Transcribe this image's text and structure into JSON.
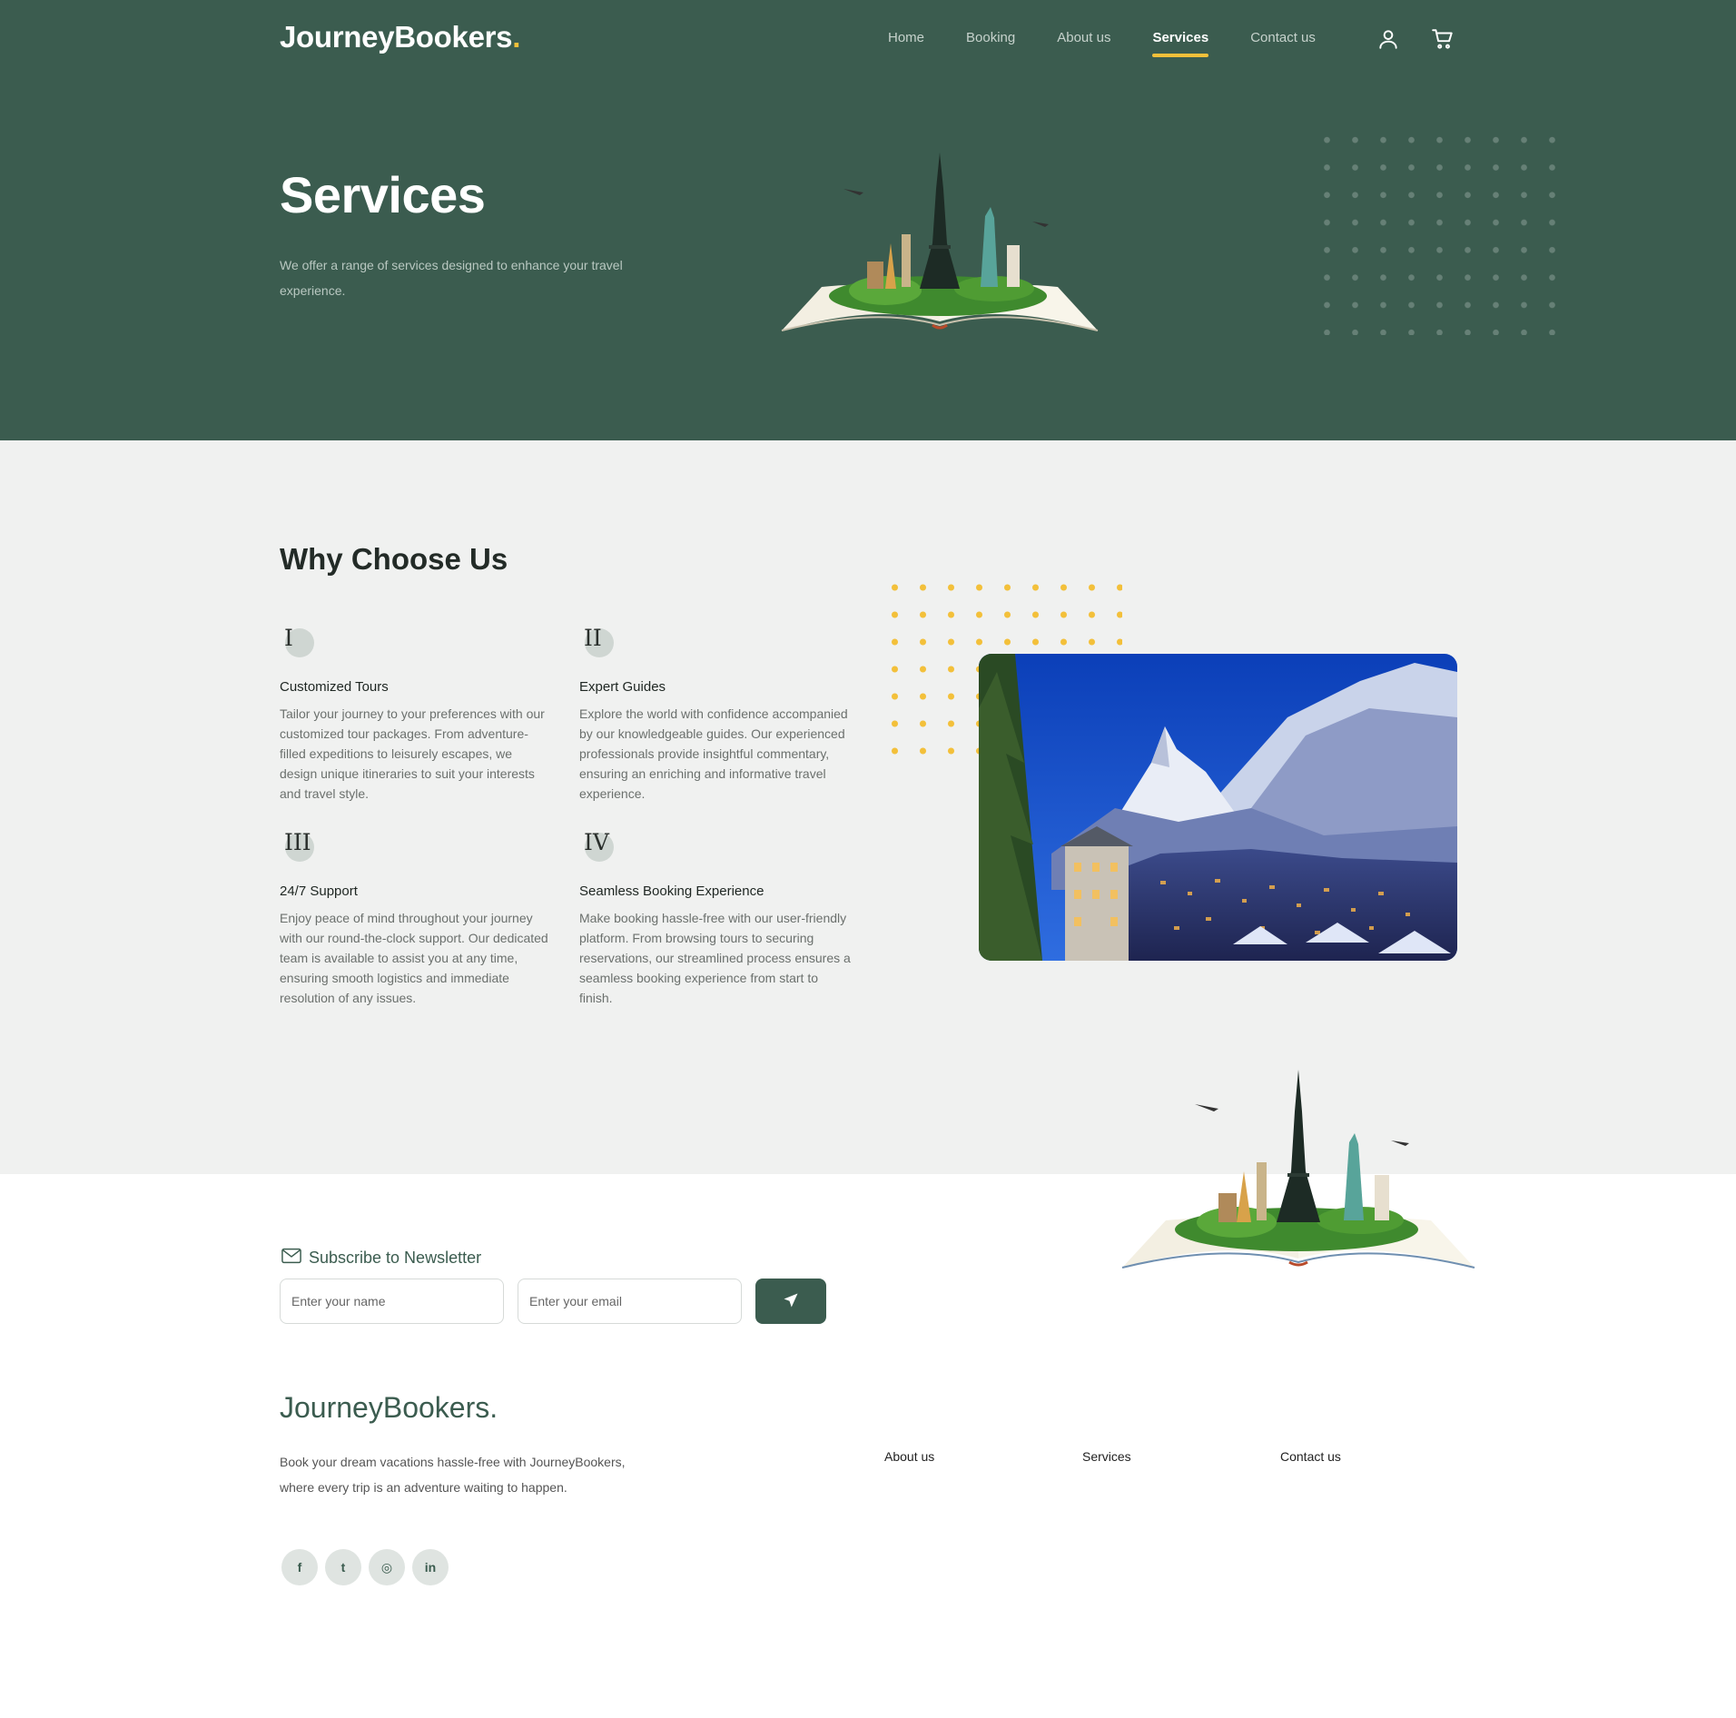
{
  "brand": {
    "name": "JourneyBookers",
    "dot": ".",
    "accent": "#f3c03a",
    "primary": "#3b5c4f"
  },
  "nav": {
    "items": [
      "Home",
      "Booking",
      "About us",
      "Services",
      "Contact us"
    ],
    "active": "Services",
    "icons": [
      "user-icon",
      "cart-icon"
    ]
  },
  "hero": {
    "title": "Services",
    "subtitle": "We offer a range of services designed to enhance your travel experience."
  },
  "why": {
    "title": "Why Choose Us",
    "features": [
      {
        "numeral": "I",
        "title": "Customized Tours",
        "text": "Tailor your journey to your preferences with our customized tour packages. From adventure-filled expeditions to leisurely escapes, we design unique itineraries to suit your interests and travel style."
      },
      {
        "numeral": "II",
        "title": "Expert Guides",
        "text": "Explore the world with confidence accompanied by our knowledgeable guides. Our experienced professionals provide insightful commentary, ensuring an enriching and informative travel experience."
      },
      {
        "numeral": "III",
        "title": "24/7 Support",
        "text": "Enjoy peace of mind throughout your journey with our round-the-clock support. Our dedicated team is available to assist you at any time, ensuring smooth logistics and immediate resolution of any issues."
      },
      {
        "numeral": "IV",
        "title": "Seamless Booking Experience",
        "text": "Make booking hassle-free with our user-friendly platform. From browsing tours to securing reservations, our streamlined process ensures a seamless booking experience from start to finish."
      }
    ]
  },
  "newsletter": {
    "title": "Subscribe to Newsletter",
    "name_placeholder": "Enter your name",
    "email_placeholder": "Enter your email",
    "submit_icon": "send-icon"
  },
  "footer": {
    "logo": "JourneyBookers.",
    "text": "Book your dream vacations hassle-free with JourneyBookers, where every trip is an adventure waiting to happen.",
    "links": [
      "About us",
      "Services",
      "Contact us"
    ],
    "social": [
      {
        "icon": "facebook-icon",
        "glyph": "f"
      },
      {
        "icon": "twitter-icon",
        "glyph": "t"
      },
      {
        "icon": "instagram-icon",
        "glyph": "◎"
      },
      {
        "icon": "linkedin-icon",
        "glyph": "in"
      }
    ]
  }
}
